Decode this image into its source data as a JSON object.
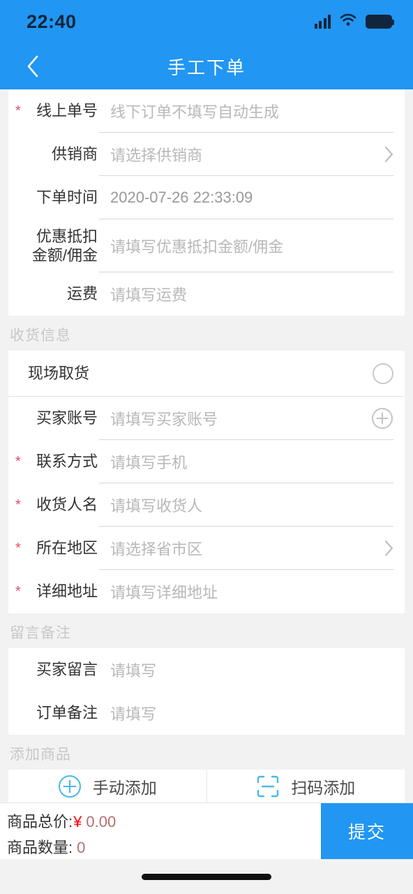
{
  "status_bar": {
    "time": "22:40",
    "icons": [
      "signal-icon",
      "wifi-icon",
      "battery-icon"
    ]
  },
  "nav": {
    "title": "手工下单",
    "back_icon": "chevron-left-icon"
  },
  "order_card": {
    "rows": [
      {
        "label": "线上单号",
        "required": true,
        "placeholder": "线下订单不填写自动生成",
        "value": "",
        "trail": "none"
      },
      {
        "label": "供销商",
        "required": false,
        "placeholder": "请选择供销商",
        "value": "",
        "trail": "chevron-right-icon"
      },
      {
        "label": "下单时间",
        "required": false,
        "placeholder": "",
        "value": "2020-07-26 22:33:09",
        "trail": "none"
      },
      {
        "label": "优惠抵扣\n金额/佣金",
        "required": false,
        "placeholder": "请填写优惠抵扣金额/佣金",
        "value": "",
        "trail": "none"
      },
      {
        "label": "运费",
        "required": false,
        "placeholder": "请填写运费",
        "value": "",
        "trail": "none"
      }
    ]
  },
  "shipping": {
    "section_title": "收货信息",
    "pickup": {
      "label": "现场取货",
      "control": "radio-unchecked",
      "checked": false
    },
    "rows": [
      {
        "label": "买家账号",
        "required": false,
        "placeholder": "请填写买家账号",
        "value": "",
        "trail": "plus-circle-icon"
      },
      {
        "label": "联系方式",
        "required": true,
        "placeholder": "请填写手机",
        "value": "",
        "trail": "none"
      },
      {
        "label": "收货人名",
        "required": true,
        "placeholder": "请填写收货人",
        "value": "",
        "trail": "none"
      },
      {
        "label": "所在地区",
        "required": true,
        "placeholder": "请选择省市区",
        "value": "",
        "trail": "chevron-right-icon"
      },
      {
        "label": "详细地址",
        "required": true,
        "placeholder": "请填写详细地址",
        "value": "",
        "trail": "none"
      }
    ]
  },
  "remarks": {
    "section_title": "留言备注",
    "rows": [
      {
        "label": "买家留言",
        "required": false,
        "placeholder": "请填写",
        "value": "",
        "trail": "none"
      },
      {
        "label": "订单备注",
        "required": false,
        "placeholder": "请填写",
        "value": "",
        "trail": "none"
      }
    ]
  },
  "add_product": {
    "section_title": "添加商品",
    "buttons": [
      {
        "label": "手动添加",
        "icon": "plus-circle-icon"
      },
      {
        "label": "扫码添加",
        "icon": "scan-code-icon"
      }
    ]
  },
  "bottom_bar": {
    "total_price_label": "商品总价:",
    "currency_symbol": "¥",
    "total_price_value": "0.00",
    "total_qty_label": "商品数量:",
    "total_qty_value": "0",
    "submit_label": "提交"
  },
  "colors": {
    "brand_blue": "#2196f3",
    "required_red": "#e74c5e",
    "price_red": "#ff0000",
    "amount_red": "#b5706e",
    "icon_blue": "#4ab8e8",
    "placeholder_gray": "#b8b8b8",
    "section_gray": "#c8c8c8",
    "page_bg": "#f2f2f2"
  }
}
